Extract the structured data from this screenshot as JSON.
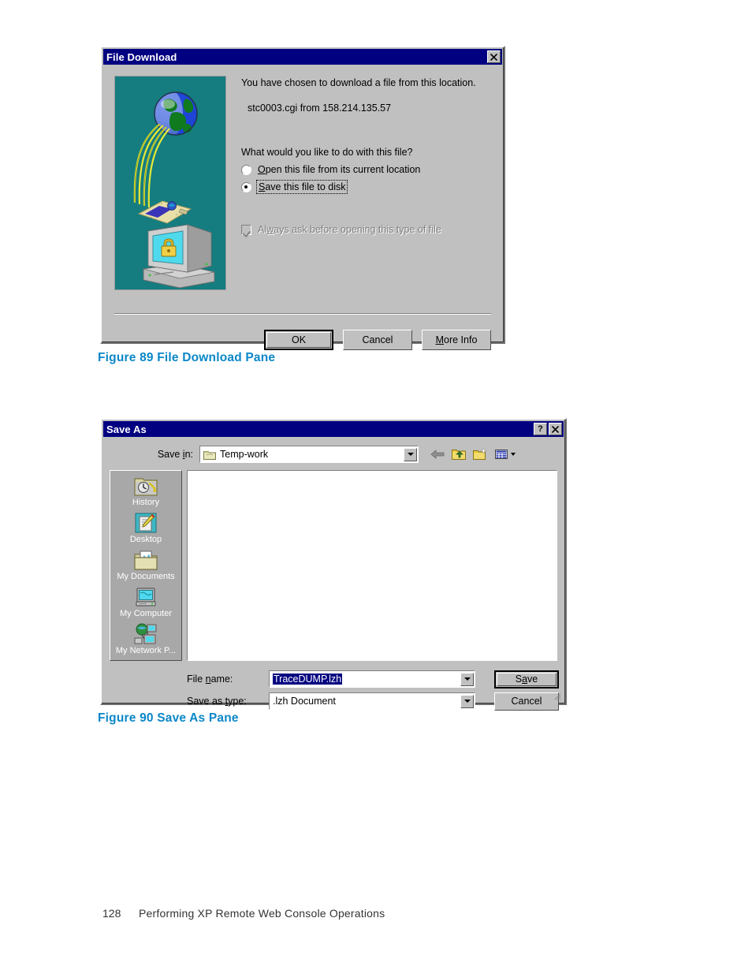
{
  "page": {
    "number": "128",
    "chapter_title": "Performing XP Remote Web Console Operations"
  },
  "figures": [
    {
      "caption": "Figure 89 File Download Pane"
    },
    {
      "caption": "Figure 90 Save As Pane"
    }
  ],
  "colors": {
    "caption_blue": "#0b87c8",
    "titlebar_navy": "#000080",
    "dialog_face": "#c0c0c0",
    "graphic_teal": "#157d80",
    "selection_navy": "#000080"
  },
  "file_download": {
    "title": "File Download",
    "close_button": "x",
    "line1": "You have chosen to download a file from this location.",
    "line2": "stc0003.cgi  from  158.214.135.57",
    "question": "What would you like to do with this file?",
    "options": [
      {
        "label_prefix": "O",
        "label_rest": "pen this file from its current location",
        "selected": false
      },
      {
        "label_prefix": "S",
        "label_rest": "ave this file to disk",
        "selected": true
      }
    ],
    "checkbox": {
      "label_prefix": "Al",
      "label_mid": "w",
      "label_rest": "ays ask before opening this type of file",
      "checked": true,
      "disabled": true
    },
    "buttons": [
      {
        "label": "OK",
        "default": true
      },
      {
        "label": "Cancel",
        "default": false
      },
      {
        "label_prefix": "M",
        "label_rest": "ore Info",
        "default": false
      }
    ],
    "graphic": "globe-network-computer-lock-illustration"
  },
  "save_as": {
    "title": "Save As",
    "help_button": "?",
    "close_button": "x",
    "save_in": {
      "label_prefix": "Save ",
      "label_mid": "i",
      "label_rest": "n:",
      "value": "Temp-work",
      "icon": "folder-icon"
    },
    "toolbar": [
      {
        "name": "back-icon"
      },
      {
        "name": "up-one-level-icon"
      },
      {
        "name": "new-folder-icon"
      },
      {
        "name": "views-icon"
      }
    ],
    "places": [
      {
        "label": "History",
        "icon": "history-icon"
      },
      {
        "label": "Desktop",
        "icon": "desktop-icon"
      },
      {
        "label": "My Documents",
        "icon": "my-documents-icon"
      },
      {
        "label": "My Computer",
        "icon": "my-computer-icon"
      },
      {
        "label": "My Network P...",
        "icon": "my-network-places-icon"
      }
    ],
    "file_list": {
      "items": []
    },
    "file_name": {
      "label_prefix": "File ",
      "label_mid": "n",
      "label_rest": "ame:",
      "value": "TraceDUMP.lzh",
      "selected": true
    },
    "save_as_type": {
      "label_prefix": "Save as ",
      "label_mid": "t",
      "label_rest": "ype:",
      "value": ".lzh Document"
    },
    "buttons": [
      {
        "label_prefix": "S",
        "label_mid": "a",
        "label_rest": "ve",
        "default": true
      },
      {
        "label": "Cancel",
        "default": false
      }
    ]
  }
}
